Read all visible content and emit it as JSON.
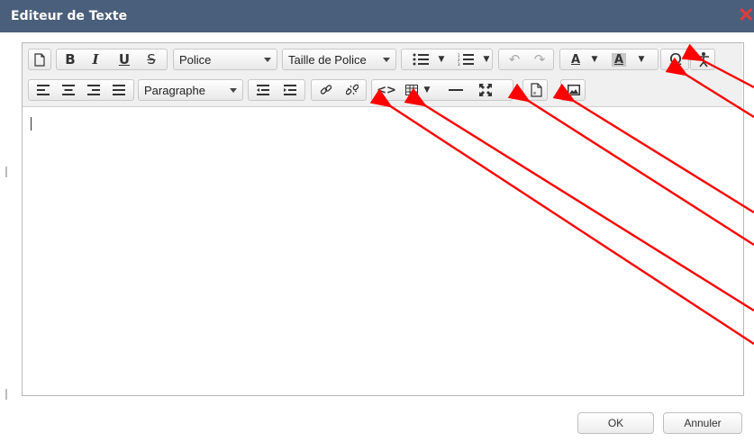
{
  "dialog": {
    "title": "Editeur de Texte",
    "close_glyph": "✕"
  },
  "toolbar": {
    "row1": {
      "new_doc_icon": "new-document-icon",
      "bold": "B",
      "italic": "I",
      "underline": "U",
      "strike": "S",
      "font": "Police",
      "font_size": "Taille de Police",
      "bullet_list_icon": "bullet-list-icon",
      "numbered_list_icon": "numbered-list-icon",
      "undo_icon": "undo-icon",
      "redo_icon": "redo-icon",
      "text_color": "A",
      "bg_color": "A",
      "special_char": "Ω",
      "accessibility_icon": "accessibility-icon"
    },
    "row2": {
      "align_left_icon": "align-left-icon",
      "align_center_icon": "align-center-icon",
      "align_right_icon": "align-right-icon",
      "justify_icon": "justify-icon",
      "format": "Paragraphe",
      "outdent_icon": "outdent-icon",
      "indent_icon": "indent-icon",
      "link_icon": "link-icon",
      "unlink_icon": "unlink-icon",
      "code": "<>",
      "table_icon": "table-icon",
      "hr_icon": "horizontal-rule-icon",
      "fullscreen_icon": "fullscreen-icon",
      "template_icon": "document-template-icon",
      "image_icon": "image-icon"
    }
  },
  "footer": {
    "ok": "OK",
    "cancel": "Annuler"
  },
  "colors": {
    "titlebar": "#4a5f7b",
    "close": "#e23b3b",
    "annotation_arrow": "#ff0000"
  }
}
